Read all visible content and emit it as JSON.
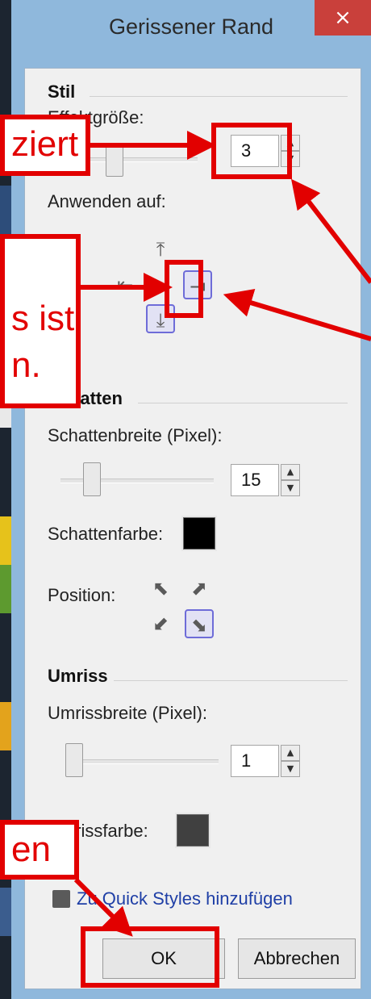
{
  "dialog": {
    "title": "Gerissener Rand",
    "close_glyph": "×"
  },
  "stil": {
    "heading": "Stil",
    "effect_size_label": "Effektgröße:",
    "effect_size_value": "3",
    "apply_to_label": "Anwenden auf:",
    "selected_edges": [
      "rechts",
      "unten"
    ]
  },
  "schatten": {
    "heading": "Schatten",
    "width_label": "Schattenbreite (Pixel):",
    "width_value": "15",
    "color_label": "Schattenfarbe:",
    "color": "#000000",
    "position_label": "Position:",
    "selected_position": "unten-rechts"
  },
  "umriss": {
    "heading": "Umriss",
    "width_label": "Umrissbreite (Pixel):",
    "width_value": "1",
    "color_label": "Umrissfarbe:",
    "color": "#404040"
  },
  "quick_styles_link": "Zu Quick Styles hinzufügen",
  "buttons": {
    "ok": "OK",
    "cancel": "Abbrechen"
  },
  "annotations": {
    "callout_top": "ziert",
    "callout_middle_line1": "s ist",
    "callout_middle_line2": "n.",
    "callout_bottom": "en"
  },
  "colors": {
    "accent_red": "#e20000",
    "title_bar": "#8fb8dc",
    "close": "#c9403b",
    "selection": "#6e6cd8"
  },
  "icons": [
    "close-icon",
    "arrow-up-to-bar-icon",
    "arrow-left-to-bar-icon",
    "arrow-right-to-bar-icon",
    "arrow-down-to-bar-icon",
    "diagonal-arrow-icon",
    "save-disk-icon"
  ]
}
